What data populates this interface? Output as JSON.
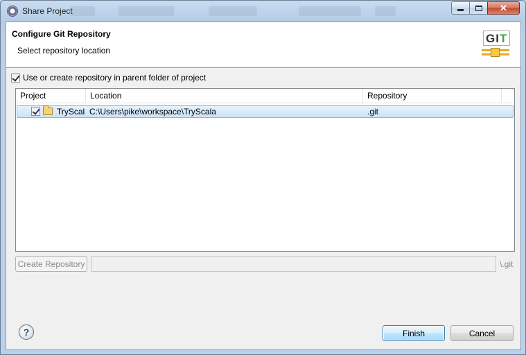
{
  "window": {
    "title": "Share Project"
  },
  "header": {
    "title": "Configure Git Repository",
    "subtitle": "Select repository location",
    "logo_text_g": "G",
    "logo_text_i": "I",
    "logo_text_t": "T"
  },
  "options": {
    "use_parent_label": "Use or create repository in parent folder of project",
    "use_parent_checked": true
  },
  "table": {
    "columns": [
      "Project",
      "Location",
      "Repository"
    ],
    "rows": [
      {
        "checked": true,
        "project": "TryScala",
        "location": "C:\\Users\\pike\\workspace\\TryScala",
        "repository": ".git"
      }
    ]
  },
  "create": {
    "button_label": "Create Repository",
    "path_value": "",
    "suffix": "\\.git"
  },
  "footer": {
    "help_glyph": "?",
    "finish_label": "Finish",
    "cancel_label": "Cancel"
  },
  "colors": {
    "accent": "#3c7fb1",
    "selection": "#cce3f7",
    "git_green": "#3aa545",
    "git_orange": "#e8a820"
  }
}
